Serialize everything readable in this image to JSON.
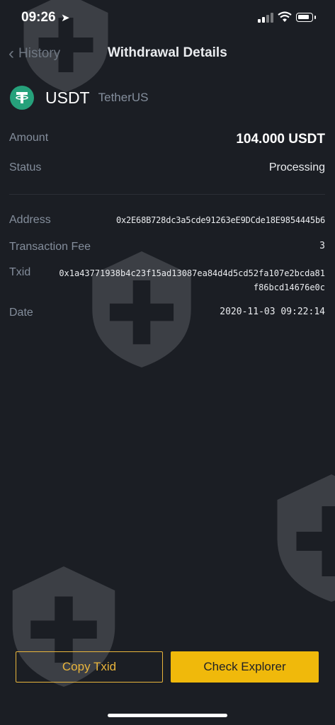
{
  "status_bar": {
    "time": "09:26"
  },
  "nav": {
    "back_label": "History",
    "title": "Withdrawal Details"
  },
  "coin": {
    "symbol": "USDT",
    "name": "TetherUS"
  },
  "details": {
    "amount_label": "Amount",
    "amount_value": "104.000 USDT",
    "status_label": "Status",
    "status_value": "Processing",
    "address_label": "Address",
    "address_value": "0x2E68B728dc3a5cde91263eE9DCde18E9854445b6",
    "fee_label": "Transaction Fee",
    "fee_value": "3",
    "txid_label": "Txid",
    "txid_value": "0x1a43771938b4c23f15ad13087ea84d4d5cd52fa107e2bcda81f86bcd14676e0c",
    "date_label": "Date",
    "date_value": "2020-11-03 09:22:14"
  },
  "buttons": {
    "copy_txid": "Copy Txid",
    "check_explorer": "Check Explorer"
  },
  "colors": {
    "background": "#1b1e24",
    "accent": "#f0b90b",
    "tether": "#26a17b",
    "muted": "#848e9c"
  },
  "icons": [
    "location-arrow-icon",
    "signal-icon",
    "wifi-icon",
    "battery-icon",
    "chevron-left-icon",
    "tether-logo-icon",
    "shield-plus-watermark-icon"
  ]
}
